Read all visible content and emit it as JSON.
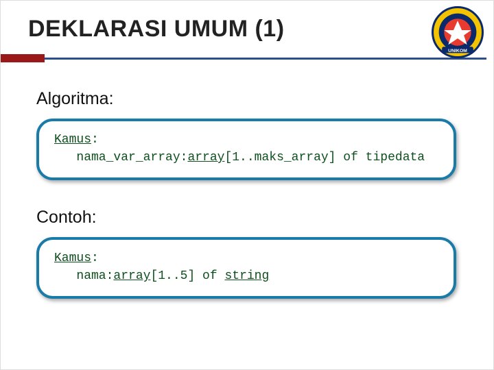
{
  "title": "DEKLARASI UMUM (1)",
  "logo_label": "UNIKOM",
  "sections": {
    "algo_label": "Algoritma:",
    "contoh_label": "Contoh:"
  },
  "code1": {
    "kamus": "Kamus",
    "colon1": ":",
    "indent": "   ",
    "varname": "nama_var_array:",
    "arraykw": "array",
    "bracket": "[1..maks_array] of tipedata"
  },
  "code2": {
    "kamus": "Kamus",
    "colon1": ":",
    "indent": "   ",
    "varname": "nama:",
    "arraykw": "array",
    "bracket": "[1..5] of ",
    "stringkw": "string"
  }
}
